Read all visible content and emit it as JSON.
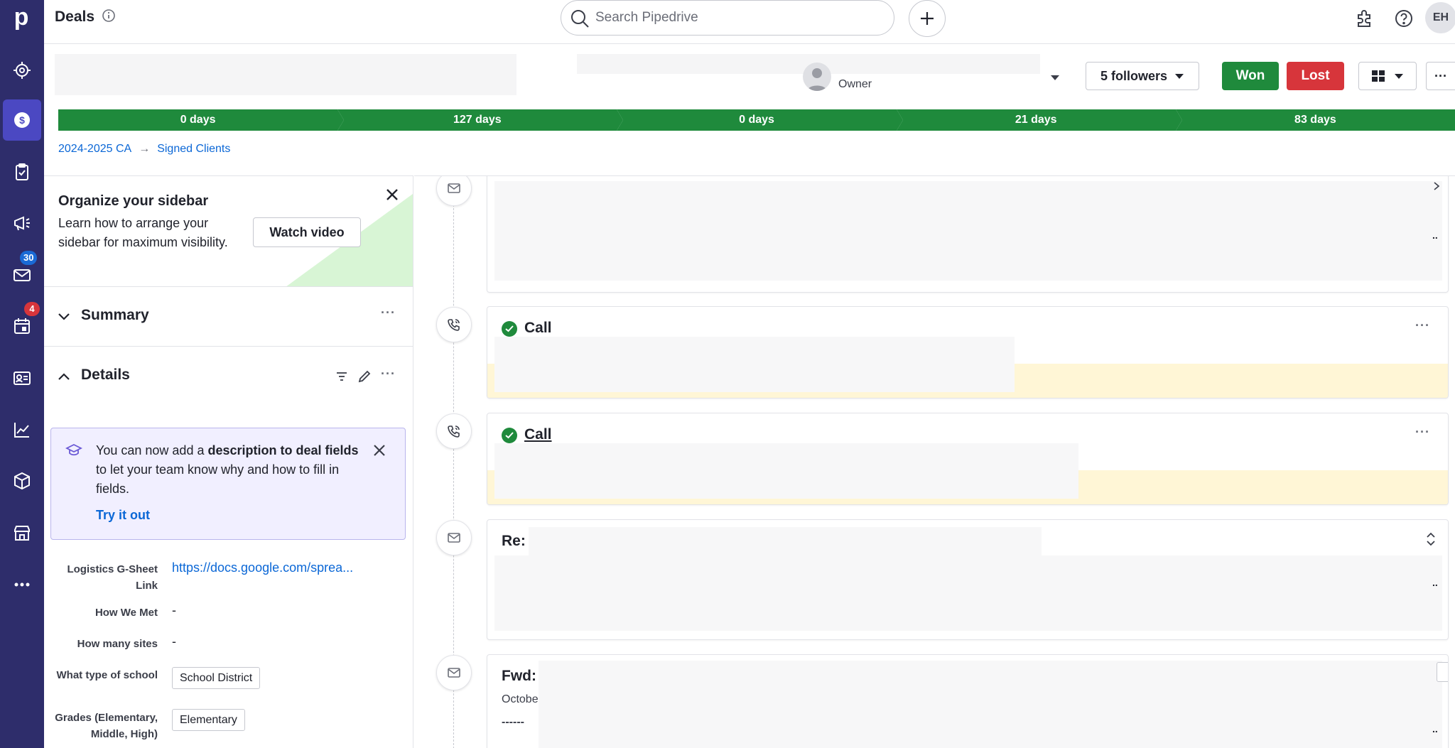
{
  "rail": {
    "logo": "p",
    "items": [
      {
        "name": "leads-icon"
      },
      {
        "name": "deals-icon"
      },
      {
        "name": "activities-icon"
      },
      {
        "name": "campaigns-icon"
      },
      {
        "name": "mail-icon",
        "badge": "30",
        "badge_color": "#1a6ad5"
      },
      {
        "name": "calendar-icon",
        "badge": "4",
        "badge_color": "#d7353b"
      },
      {
        "name": "contacts-icon"
      },
      {
        "name": "insights-icon"
      },
      {
        "name": "products-icon"
      },
      {
        "name": "marketplace-icon"
      },
      {
        "name": "more-icon"
      }
    ]
  },
  "topbar": {
    "title": "Deals",
    "search_placeholder": "Search Pipedrive",
    "avatar_initials": "EH"
  },
  "deal_header": {
    "owner_label": "Owner",
    "followers_label": "5 followers",
    "won_label": "Won",
    "lost_label": "Lost",
    "more_label": "···"
  },
  "pipeline": {
    "stages": [
      "0 days",
      "127 days",
      "0 days",
      "21 days",
      "83 days"
    ],
    "color": "#1f8a3c"
  },
  "breadcrumb": {
    "pipeline": "2024-2025 CA",
    "arrow": "→",
    "stage": "Signed Clients"
  },
  "sidebar": {
    "org_card": {
      "title": "Organize your sidebar",
      "description": "Learn how to arrange your sidebar for maximum visibility.",
      "button": "Watch video"
    },
    "summary": {
      "title": "Summary",
      "more": "···"
    },
    "details": {
      "title": "Details",
      "more": "···"
    },
    "tip": {
      "text_before": "You can now add a ",
      "text_bold": "description to deal fields",
      "text_after": " to let your team know why and how to fill in fields.",
      "link": "Try it out"
    },
    "fields": [
      {
        "label": "Logistics G-Sheet Link",
        "value": "https://docs.google.com/sprea..."
      },
      {
        "label": "How We Met",
        "value": "-"
      },
      {
        "label": "How many sites",
        "value": "-"
      },
      {
        "label": "What type of school",
        "value": "School District"
      },
      {
        "label": "Grades (Elementary, Middle, High)",
        "value": "Elementary"
      }
    ]
  },
  "timeline": {
    "items": [
      {
        "type": "email",
        "title": ""
      },
      {
        "type": "call",
        "title": "Call",
        "more": "···"
      },
      {
        "type": "call",
        "title": "Call",
        "more": "···"
      },
      {
        "type": "email",
        "title": "Re:"
      },
      {
        "type": "email",
        "title": "Fwd:",
        "line1": "Octobe",
        "line2": "------"
      }
    ],
    "trailing_dots": ".."
  }
}
